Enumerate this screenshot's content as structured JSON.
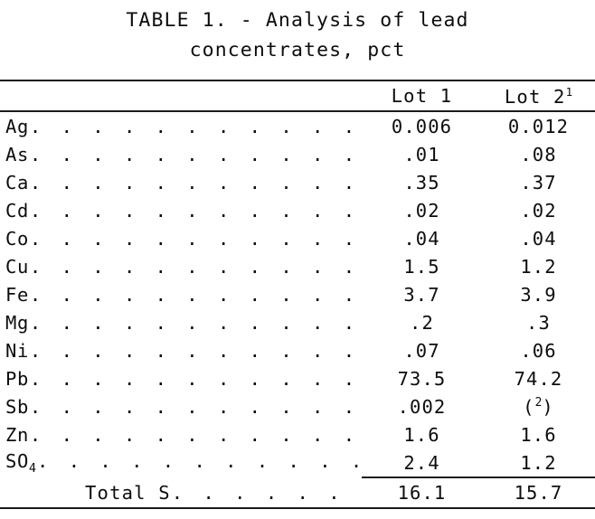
{
  "document": {
    "title_line_1": "TABLE 1. - Analysis of lead",
    "title_line_2": "concentrates, pct"
  },
  "table": {
    "columns": [
      {
        "key": "label",
        "header": ""
      },
      {
        "key": "lot1",
        "header": "Lot 1",
        "footnote": ""
      },
      {
        "key": "lot2",
        "header": "Lot 2",
        "footnote": "1"
      }
    ],
    "leader_dots": ". . . . . . . . . . . . . . . . . . . . . . . . . . . . . . . . . . . .",
    "rows": [
      {
        "element": "Ag",
        "lot1": "0.006",
        "lot2": "0.012"
      },
      {
        "element": "As",
        "lot1": ".01",
        "lot2": ".08"
      },
      {
        "element": "Ca",
        "lot1": ".35",
        "lot2": ".37"
      },
      {
        "element": "Cd",
        "lot1": ".02",
        "lot2": ".02"
      },
      {
        "element": "Co",
        "lot1": ".04",
        "lot2": ".04"
      },
      {
        "element": "Cu",
        "lot1": "1.5",
        "lot2": "1.2"
      },
      {
        "element": "Fe",
        "lot1": "3.7",
        "lot2": "3.9"
      },
      {
        "element": "Mg",
        "lot1": ".2",
        "lot2": ".3"
      },
      {
        "element": "Ni",
        "lot1": ".07",
        "lot2": ".06"
      },
      {
        "element": "Pb",
        "lot1": "73.5",
        "lot2": "74.2"
      },
      {
        "element": "Sb",
        "lot1": ".002",
        "lot2": "(2)",
        "lot2_sup": "2",
        "lot2_is_footnote_ref": true
      },
      {
        "element": "Zn",
        "lot1": "1.6",
        "lot2": "1.6"
      },
      {
        "element": "SO",
        "element_sub": "4",
        "lot1": "2.4",
        "lot2": "1.2"
      }
    ],
    "total_row": {
      "label": "Total S",
      "lot1": "16.1",
      "lot2": "15.7"
    }
  },
  "colors": {
    "ink": "#0d0d0d",
    "rule": "#1a1a1a",
    "paper": "#ffffff"
  }
}
